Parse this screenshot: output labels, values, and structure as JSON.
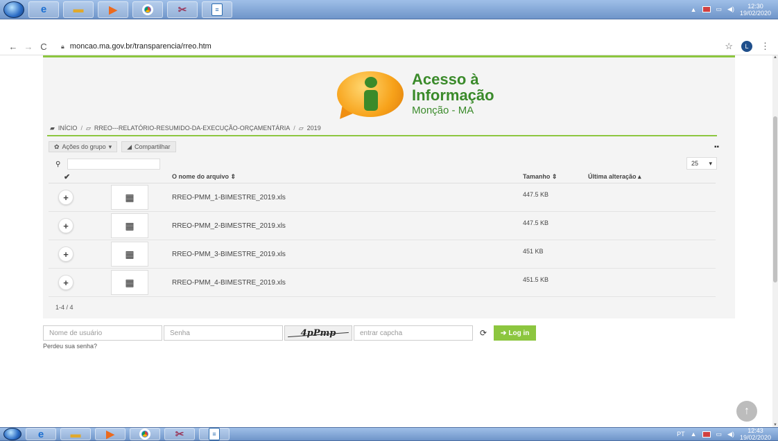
{
  "taskbar_top": {
    "clock_time": "12:30",
    "clock_date": "19/02/2020"
  },
  "taskbar_bottom": {
    "lang": "PT",
    "clock_time": "12:43",
    "clock_date": "19/02/2020"
  },
  "browser": {
    "url": "moncao.ma.gov.br/transparencia/rreo.htm",
    "profile_initial": "L"
  },
  "logo": {
    "line1": "Acesso à",
    "line2": "Informação",
    "subtitle": "Monção - MA"
  },
  "breadcrumb": {
    "home": "INÍCIO",
    "sep": "/",
    "level1": "RREO---RELATÓRIO-RESUMIDO-DA-EXECUÇÃO-ORÇAMENTÁRIA",
    "level2": "2019"
  },
  "toolbar": {
    "group_actions": "Ações do grupo",
    "share": "Compartilhar",
    "per_page": "25"
  },
  "table": {
    "columns": {
      "name": "O nome do arquivo",
      "size": "Tamanho",
      "modified": "Última alteração"
    },
    "rows": [
      {
        "name": "RREO-PMM_1-BIMESTRE_2019.xls",
        "size": "447.5 KB"
      },
      {
        "name": "RREO-PMM_2-BIMESTRE_2019.xls",
        "size": "447.5 KB"
      },
      {
        "name": "RREO-PMM_3-BIMESTRE_2019.xls",
        "size": "451 KB"
      },
      {
        "name": "RREO-PMM_4-BIMESTRE_2019.xls",
        "size": "451.5 KB"
      }
    ],
    "pager": "1-4 / 4"
  },
  "login": {
    "username_placeholder": "Nome de usuário",
    "password_placeholder": "Senha",
    "captcha_text": "4pPmp",
    "captcha_placeholder": "entrar capcha",
    "login_label": "Log in",
    "forgot_label": "Perdeu sua senha?"
  },
  "colors": {
    "accent_green": "#8cc63f",
    "logo_green": "#3a8a2a",
    "logo_orange": "#f7a21a"
  },
  "icons": [
    "start-orb-icon",
    "ie-icon",
    "folder-icon",
    "media-player-icon",
    "chrome-icon",
    "snipping-tool-icon",
    "document-icon",
    "lock-icon",
    "star-icon",
    "folder-open-icon",
    "gear-icon",
    "share-icon",
    "grid-view-icon",
    "search-icon",
    "check-icon",
    "plus-icon",
    "spreadsheet-icon",
    "refresh-icon",
    "login-icon",
    "arrow-up-icon"
  ]
}
